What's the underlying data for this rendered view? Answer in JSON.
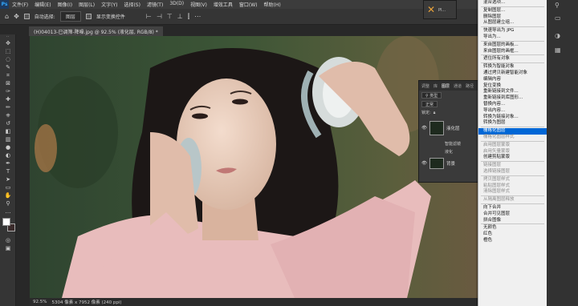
{
  "menu": [
    "文件(F)",
    "编辑(E)",
    "图像(I)",
    "图层(L)",
    "文字(Y)",
    "选择(S)",
    "滤镜(T)",
    "3D(D)",
    "视图(V)",
    "增效工具",
    "窗口(W)",
    "帮助(H)"
  ],
  "options": {
    "auto_select": "自动选择:",
    "layer_select": "图层",
    "show_transform": "显示变换控件"
  },
  "doc_tab": "(H)04013-已调筛-降噪.jpg @ 92.5% (液化层, RGB/8) *",
  "floating_label": "Pl...",
  "layers_panel": {
    "tabs": [
      "调整",
      "库",
      "图层",
      "通道",
      "路径"
    ],
    "kind_label": "类型",
    "blend_mode": "正常",
    "lock_label": "锁定:",
    "layer1_name": "液化层",
    "smart_filters": "智能滤镜",
    "liquify": "液化",
    "layer2_name": "背景"
  },
  "context_menu": [
    {
      "label": "混合选项...",
      "state": "normal"
    },
    {
      "sep": true
    },
    {
      "label": "复制图层...",
      "state": "normal"
    },
    {
      "label": "删除图层",
      "state": "normal"
    },
    {
      "label": "从图层建立组...",
      "state": "normal"
    },
    {
      "sep": true
    },
    {
      "label": "快速导出为 JPG",
      "state": "normal"
    },
    {
      "label": "导出为...",
      "state": "normal"
    },
    {
      "sep": true
    },
    {
      "label": "来自图层的画板...",
      "state": "normal"
    },
    {
      "label": "来自图层的画框...",
      "state": "normal"
    },
    {
      "sep": true
    },
    {
      "label": "遮住所有对象",
      "state": "normal"
    },
    {
      "sep": true
    },
    {
      "label": "转换为智能对象",
      "state": "normal"
    },
    {
      "label": "通过拷贝新建智能对象",
      "state": "normal"
    },
    {
      "label": "编辑内容",
      "state": "normal"
    },
    {
      "label": "复位变换",
      "state": "normal"
    },
    {
      "label": "重新链接到文件...",
      "state": "normal"
    },
    {
      "label": "重新链接到库图形...",
      "state": "normal"
    },
    {
      "label": "替换内容...",
      "state": "normal"
    },
    {
      "label": "导出内容...",
      "state": "normal"
    },
    {
      "label": "转换为链接对象...",
      "state": "normal"
    },
    {
      "label": "转换为图层",
      "state": "normal"
    },
    {
      "sep": true
    },
    {
      "label": "栅格化图层",
      "state": "highlight"
    },
    {
      "label": "栅格化图层样式",
      "state": "disabled"
    },
    {
      "sep": true
    },
    {
      "label": "启用图层蒙版",
      "state": "disabled"
    },
    {
      "label": "启用矢量蒙版",
      "state": "disabled"
    },
    {
      "label": "创建剪贴蒙版",
      "state": "normal"
    },
    {
      "sep": true
    },
    {
      "label": "链接图层",
      "state": "disabled"
    },
    {
      "label": "选择链接图层",
      "state": "disabled"
    },
    {
      "sep": true
    },
    {
      "label": "拷贝图层样式",
      "state": "disabled"
    },
    {
      "label": "粘贴图层样式",
      "state": "disabled"
    },
    {
      "label": "清除图层样式",
      "state": "disabled"
    },
    {
      "sep": true
    },
    {
      "label": "从隔离图层释放",
      "state": "disabled"
    },
    {
      "sep": true
    },
    {
      "label": "向下合并",
      "state": "normal"
    },
    {
      "label": "合并可见图层",
      "state": "normal"
    },
    {
      "label": "拼合图像",
      "state": "normal"
    },
    {
      "sep": true
    },
    {
      "label": "无颜色",
      "state": "normal"
    },
    {
      "label": "红色",
      "state": "normal"
    },
    {
      "label": "橙色",
      "state": "normal"
    }
  ],
  "status": {
    "zoom": "92.5%",
    "dims": "5304 像素 x 7952 像素 (240 ppi)"
  }
}
